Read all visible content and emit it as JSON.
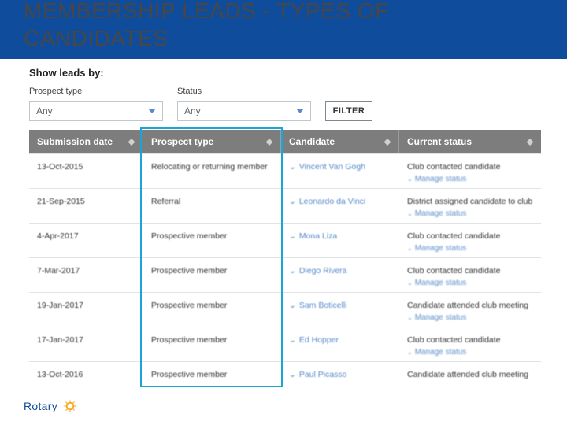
{
  "title": "MEMBERSHIP LEADS - TYPES OF\nCANDIDATES",
  "filters": {
    "header": "Show leads by:",
    "prospect_label": "Prospect type",
    "prospect_value": "Any",
    "status_label": "Status",
    "status_value": "Any",
    "button": "FILTER"
  },
  "columns": {
    "submission": "Submission date",
    "prospect": "Prospect type",
    "candidate": "Candidate",
    "status": "Current status"
  },
  "rows": [
    {
      "date": "13-Oct-2015",
      "type": "Relocating or returning member",
      "candidate": "Vincent Van Gogh",
      "status": "Club contacted candidate",
      "manage": "Manage status"
    },
    {
      "date": "21-Sep-2015",
      "type": "Referral",
      "candidate": "Leonardo da Vinci",
      "status": "District assigned candidate to club",
      "manage": "Manage status"
    },
    {
      "date": "4-Apr-2017",
      "type": "Prospective member",
      "candidate": "Mona Liza",
      "status": "Club contacted candidate",
      "manage": "Manage status"
    },
    {
      "date": "7-Mar-2017",
      "type": "Prospective member",
      "candidate": "Diego Rivera",
      "status": "Club contacted candidate",
      "manage": "Manage status"
    },
    {
      "date": "19-Jan-2017",
      "type": "Prospective member",
      "candidate": "Sam Boticelli",
      "status": "Candidate attended club meeting",
      "manage": "Manage status"
    },
    {
      "date": "17-Jan-2017",
      "type": "Prospective member",
      "candidate": "Ed Hopper",
      "status": "Club contacted candidate",
      "manage": "Manage status"
    },
    {
      "date": "13-Oct-2016",
      "type": "Prospective member",
      "candidate": "Paul Picasso",
      "status": "Candidate attended club meeting",
      "manage": ""
    }
  ],
  "footer": {
    "brand": "Rotary"
  }
}
